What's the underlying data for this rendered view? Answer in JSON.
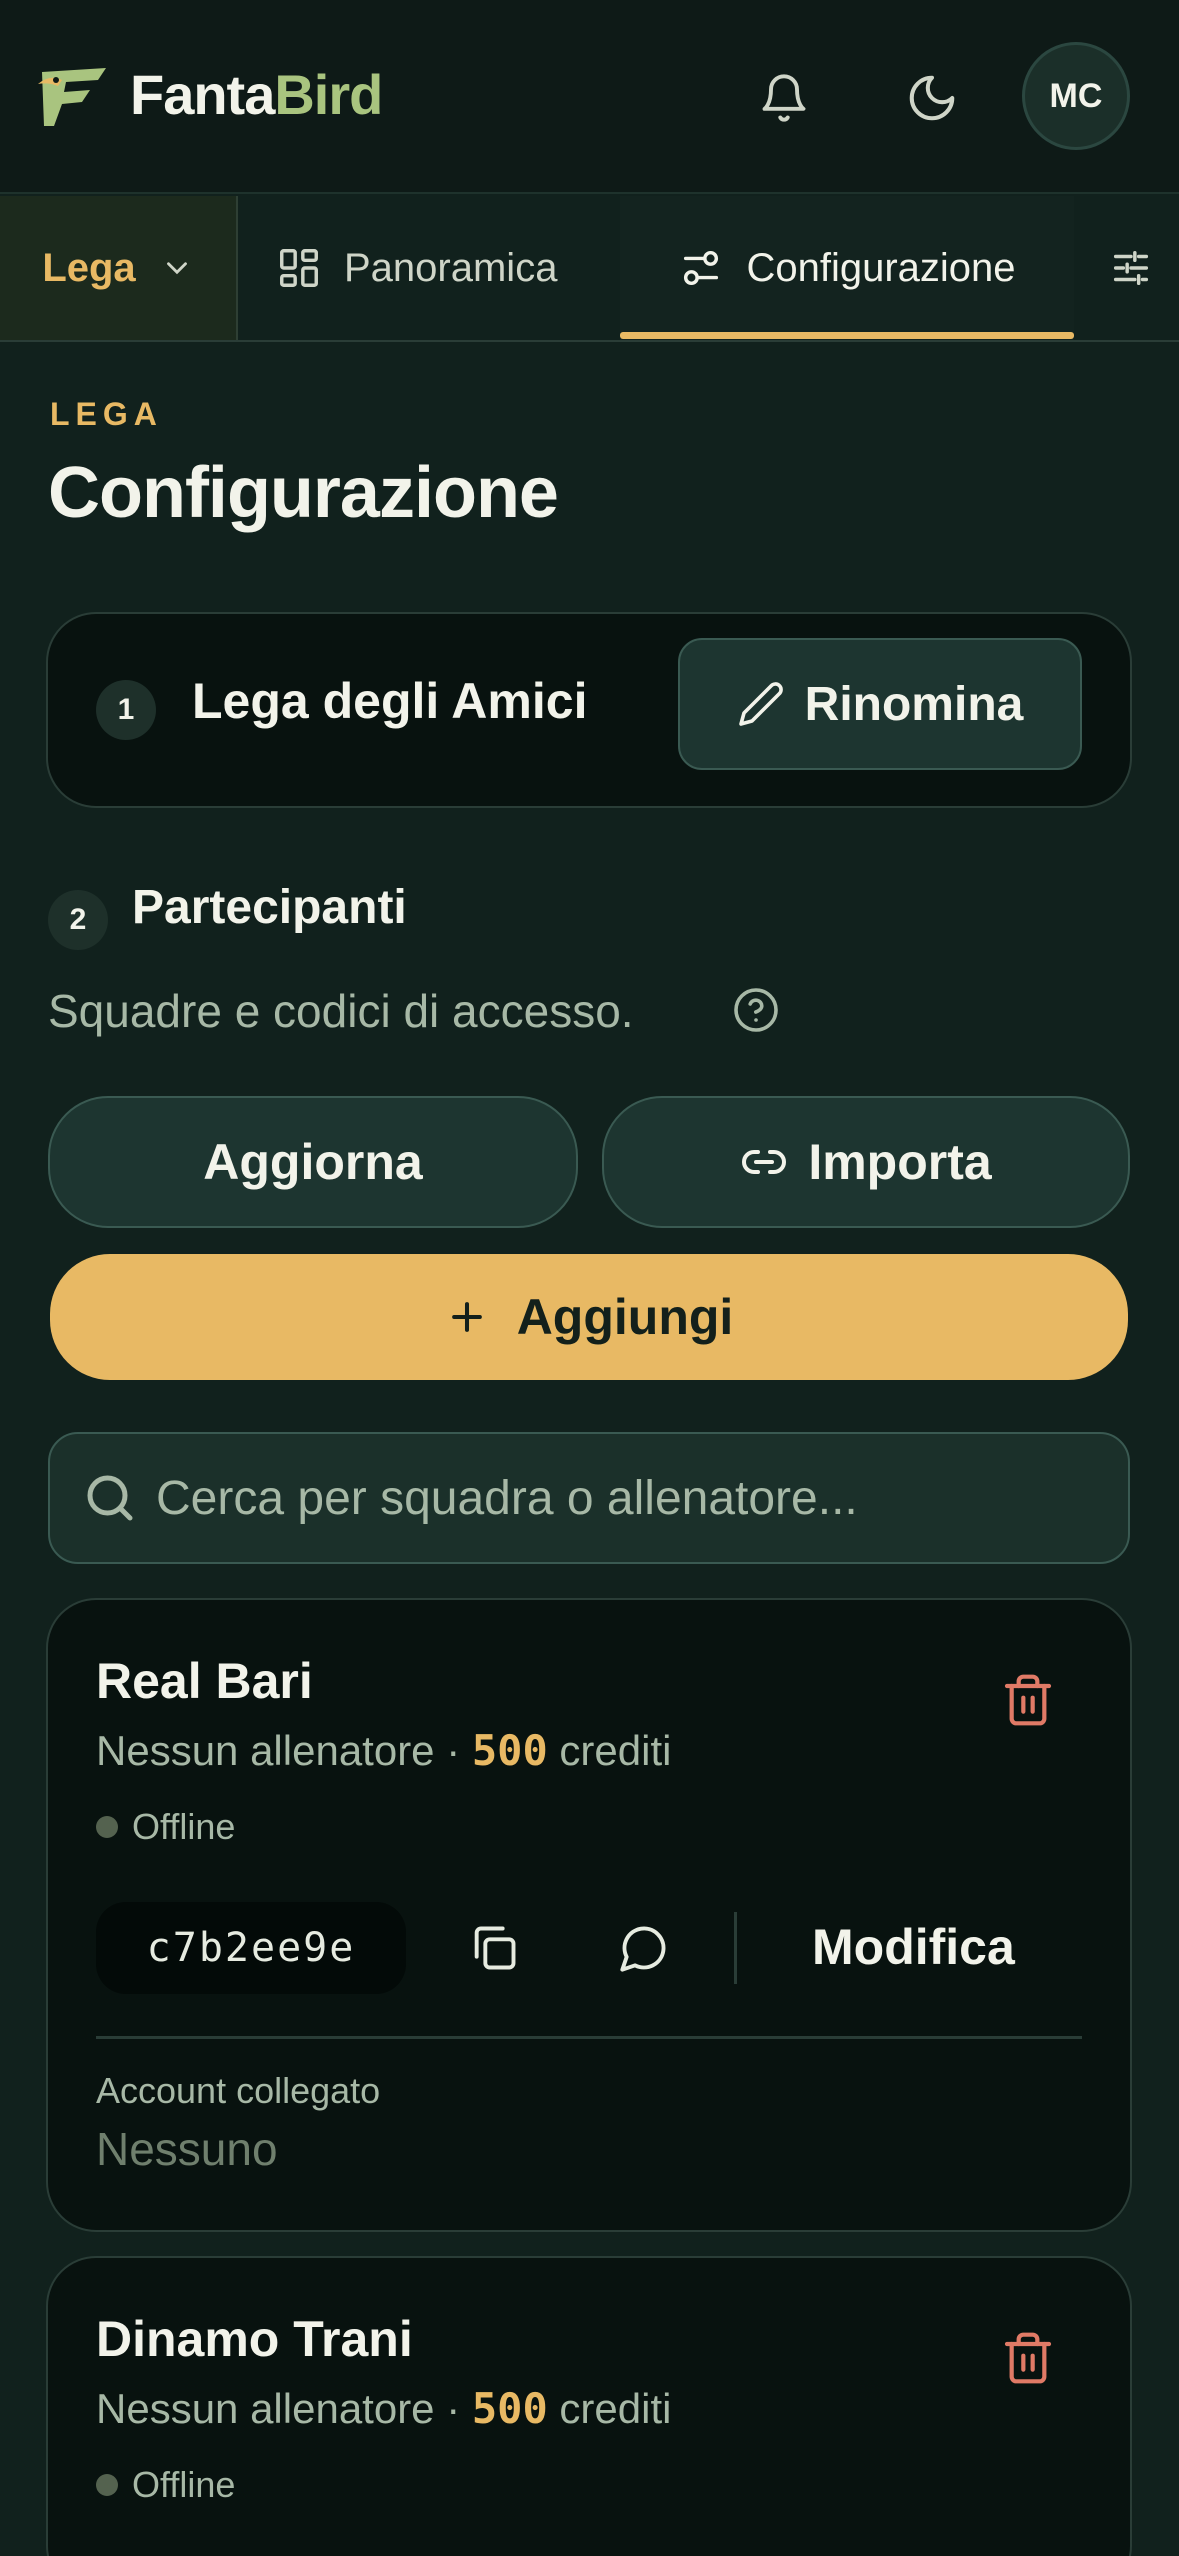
{
  "header": {
    "brand_a": "Fanta",
    "brand_b": "Bird",
    "icons": [
      "logo-icon",
      "bell-icon",
      "moon-icon"
    ],
    "avatar_initials": "MC"
  },
  "tabs": {
    "lega_label": "Lega",
    "items": [
      {
        "label": "Panoramica",
        "icon": "grid-icon"
      },
      {
        "label": "Configurazione",
        "icon": "sliders-icon",
        "active": true
      }
    ]
  },
  "page": {
    "eyebrow": "LEGA",
    "title": "Configurazione"
  },
  "league": {
    "step": "1",
    "name": "Lega degli Amici",
    "rename_label": "Rinomina"
  },
  "participants": {
    "step": "2",
    "title": "Partecipanti",
    "subtitle": "Squadre e codici di accesso.",
    "refresh_label": "Aggiorna",
    "import_label": "Importa",
    "add_label": "Aggiungi",
    "search_placeholder": "Cerca per squadra o allenatore..."
  },
  "teams": [
    {
      "name": "Real Bari",
      "coach": "Nessun allenatore",
      "sep": "·",
      "credits": "500",
      "credits_unit": "crediti",
      "status": "Offline",
      "code": "c7b2ee9e",
      "edit_label": "Modifica",
      "account_label": "Account collegato",
      "account_value": "Nessuno"
    },
    {
      "name": "Dinamo Trani",
      "coach": "Nessun allenatore",
      "sep": "·",
      "credits": "500",
      "credits_unit": "crediti",
      "status": "Offline"
    }
  ],
  "colors": {
    "background": "#11211d",
    "accent": "#e8b964",
    "danger": "#e07a66"
  }
}
